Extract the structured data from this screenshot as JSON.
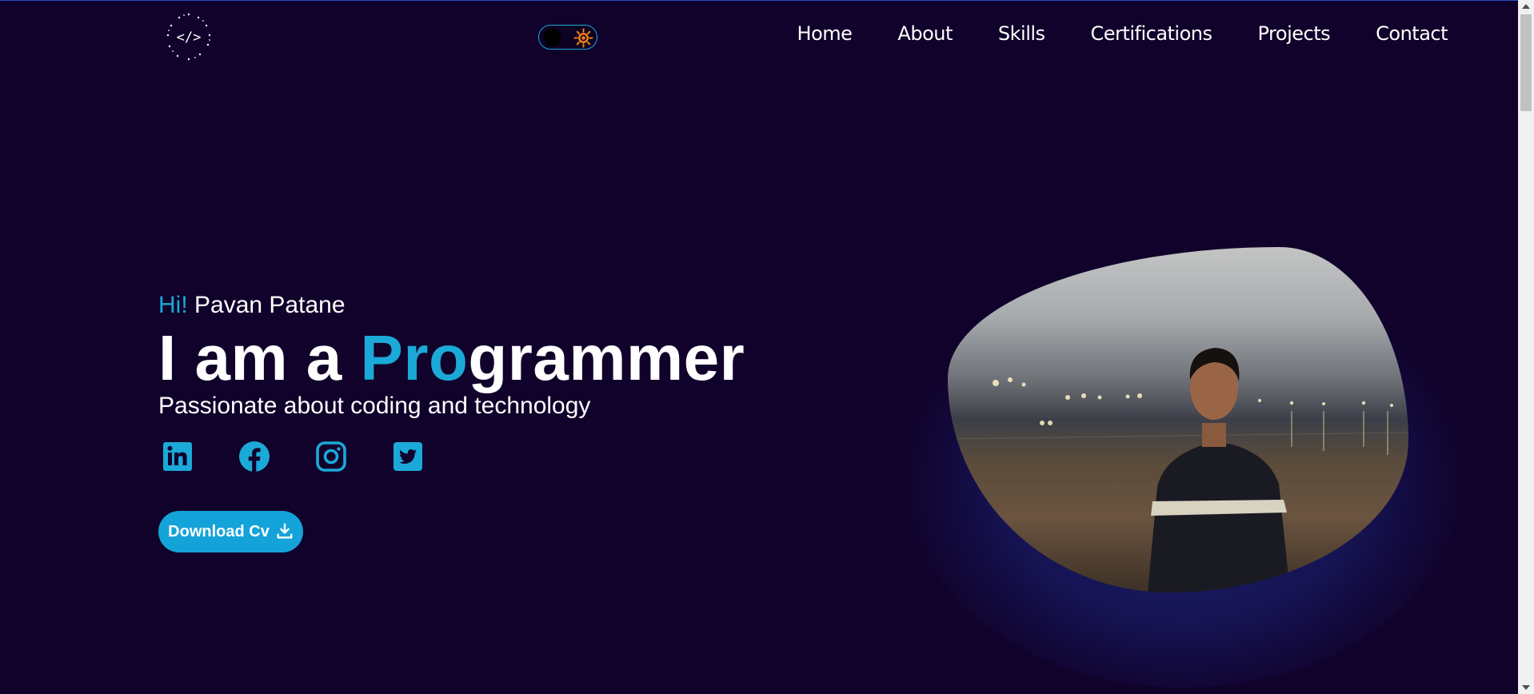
{
  "theme": {
    "background": "#10022b",
    "accent": "#1ba9d8",
    "text": "#ffffff"
  },
  "header": {
    "logo_icon": "code-tag-icon",
    "theme_toggle": {
      "knob_icon": "moon-icon",
      "sun_icon": "sun-icon",
      "state": "dark"
    }
  },
  "nav": {
    "items": [
      "Home",
      "About",
      "Skills",
      "Certifications",
      "Projects",
      "Contact"
    ]
  },
  "hero": {
    "greeting_hi": "Hi!",
    "greeting_name": "Pavan Patane",
    "headline_prefix": "I am a ",
    "headline_accent": "Pro",
    "headline_suffix": "grammer",
    "tagline": "Passionate about coding and technology"
  },
  "socials": [
    "linkedin-icon",
    "facebook-icon",
    "instagram-icon",
    "twitter-icon"
  ],
  "cta": {
    "download_label": "Download Cv",
    "download_icon": "download-icon"
  },
  "photo": {
    "alt": "profile-photo"
  }
}
